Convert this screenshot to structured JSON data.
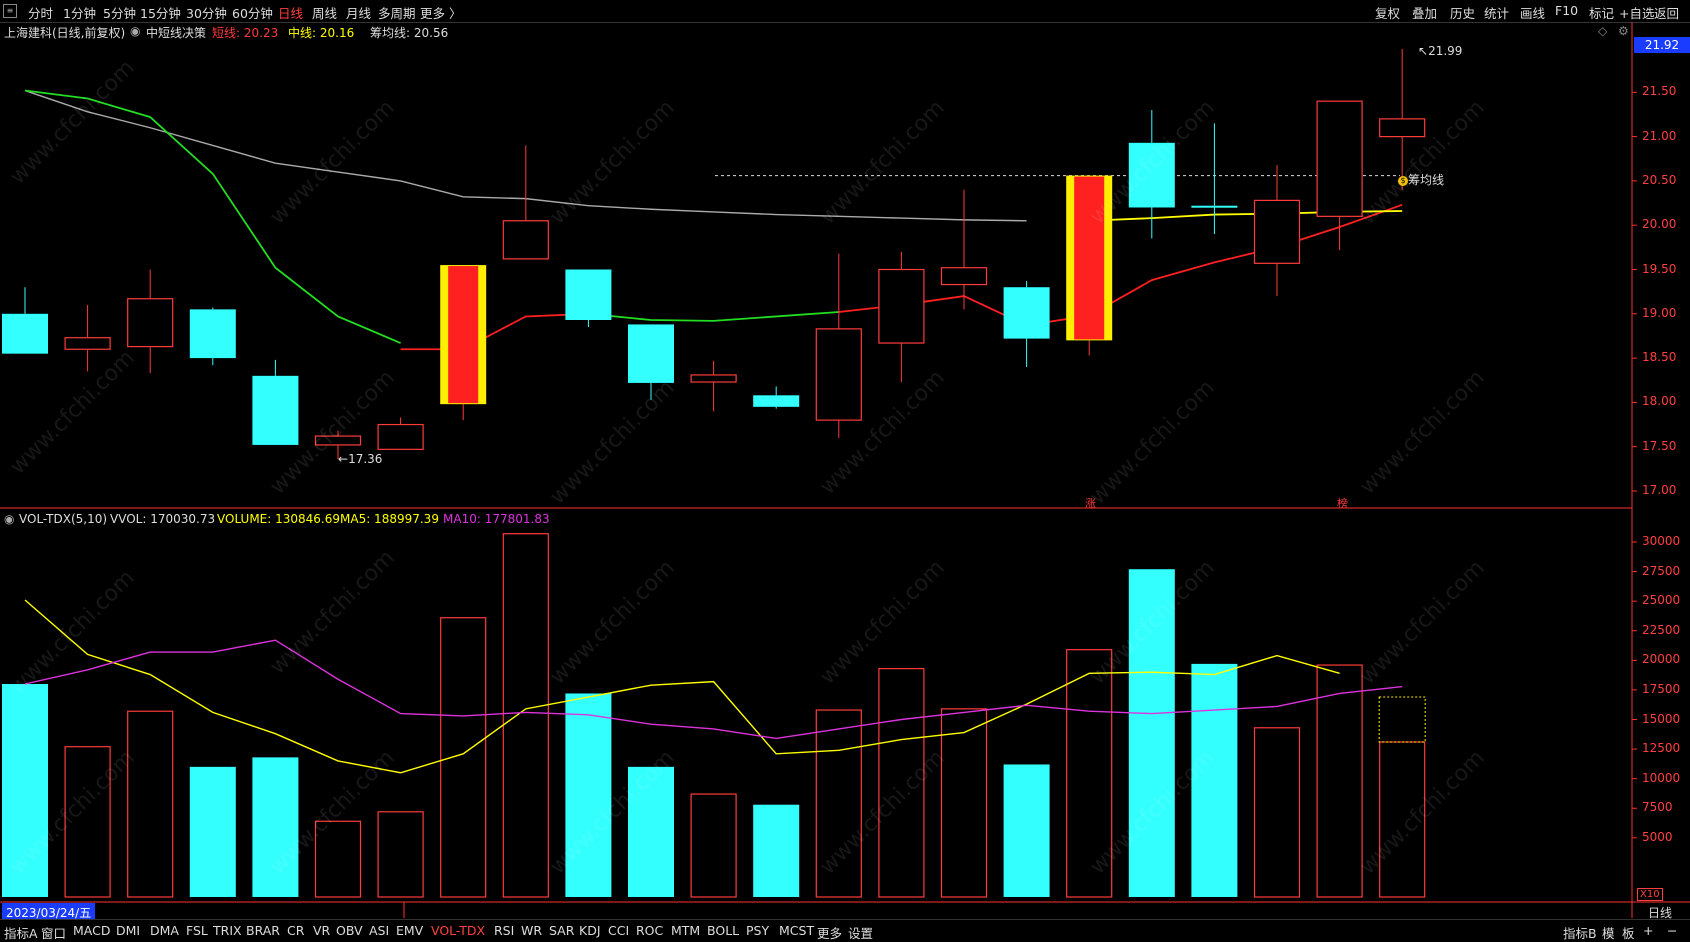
{
  "toolbar": {
    "periods": [
      "分时",
      "1分钟",
      "5分钟",
      "15分钟",
      "30分钟",
      "60分钟",
      "日线",
      "周线",
      "月线",
      "多周期",
      "更多 〉"
    ],
    "active_period": "日线",
    "right_items": [
      "复权",
      "叠加",
      "历史",
      "统计",
      "画线",
      "F10",
      "标记",
      "+自选",
      "返回"
    ]
  },
  "header": {
    "stock_title": "上海建科(日线,前复权)",
    "indicator_name": "中短线决策",
    "short_label": "短线: 20.23",
    "mid_label": "中线: 20.16",
    "chip_label": "筹均线: 20.56"
  },
  "price_axis": {
    "ticks": [
      "21.50",
      "21.00",
      "20.50",
      "20.00",
      "19.50",
      "19.00",
      "18.50",
      "18.00",
      "17.50",
      "17.00"
    ],
    "current_price": "21.92"
  },
  "annotations": {
    "high": "21.99",
    "low": "17.36",
    "chip_line_tag": "筹均线",
    "marker_zhang": "涨",
    "marker_bang": "榜"
  },
  "volume_header": {
    "name": "VOL-TDX(5,10)",
    "vvol": "VVOL: 170030.73",
    "volume": "VOLUME: 130846.69",
    "ma5": "MA5: 188997.39",
    "ma10": "MA10: 177801.83"
  },
  "volume_axis": {
    "ticks": [
      "30000",
      "27500",
      "25000",
      "22500",
      "20000",
      "17500",
      "15000",
      "12500",
      "10000",
      "7500",
      "5000"
    ],
    "multiplier": "X10"
  },
  "footer": {
    "date": "2023/03/24/五",
    "period": "日线",
    "indicators": [
      "指标A",
      "窗口",
      "MACD",
      "DMI",
      "DMA",
      "FSL",
      "TRIX",
      "BRAR",
      "CR",
      "VR",
      "OBV",
      "ASI",
      "EMV",
      "VOL-TDX",
      "RSI",
      "WR",
      "SAR",
      "KDJ",
      "CCI",
      "ROC",
      "MTM",
      "BOLL",
      "PSY",
      "MCST",
      "更多",
      "设置"
    ],
    "active_indicator": "VOL-TDX",
    "right_items": [
      "指标B",
      "模",
      "板",
      "+",
      "−"
    ]
  },
  "watermark": "www.cfchi.com",
  "colors": {
    "up": "#ff3b3b",
    "down": "#33ffff",
    "short_line": "#ff2020",
    "mid_line": "#ffff00",
    "green_line": "#22dd22",
    "gray_line": "#aaaaaa",
    "ma5": "#ffff00",
    "ma10": "#dd33dd",
    "highlight_fill": "#ff2020",
    "highlight_border": "#ffee00"
  },
  "chart_data": {
    "type": "candlestick",
    "candles": [
      {
        "o": 18.55,
        "c": 19.0,
        "h": 19.3,
        "l": 18.55,
        "dir": "down"
      },
      {
        "o": 18.6,
        "c": 18.73,
        "h": 19.1,
        "l": 18.35,
        "dir": "up"
      },
      {
        "o": 18.63,
        "c": 19.17,
        "h": 19.5,
        "l": 18.33,
        "dir": "up"
      },
      {
        "o": 19.05,
        "c": 18.5,
        "h": 19.07,
        "l": 18.42,
        "dir": "down"
      },
      {
        "o": 18.3,
        "c": 17.52,
        "h": 18.48,
        "l": 17.52,
        "dir": "down"
      },
      {
        "o": 17.52,
        "c": 17.62,
        "h": 17.68,
        "l": 17.36,
        "dir": "up"
      },
      {
        "o": 17.47,
        "c": 17.75,
        "h": 17.83,
        "l": 17.47,
        "dir": "up"
      },
      {
        "o": 17.98,
        "c": 19.55,
        "h": 19.55,
        "l": 17.8,
        "dir": "up",
        "hl": true
      },
      {
        "o": 19.62,
        "c": 20.05,
        "h": 20.9,
        "l": 19.62,
        "dir": "up"
      },
      {
        "o": 19.5,
        "c": 18.93,
        "h": 19.5,
        "l": 18.85,
        "dir": "down"
      },
      {
        "o": 18.88,
        "c": 18.22,
        "h": 18.88,
        "l": 18.03,
        "dir": "down"
      },
      {
        "o": 18.23,
        "c": 18.31,
        "h": 18.47,
        "l": 17.9,
        "dir": "up"
      },
      {
        "o": 18.08,
        "c": 17.95,
        "h": 18.18,
        "l": 17.93,
        "dir": "down"
      },
      {
        "o": 17.8,
        "c": 18.83,
        "h": 19.68,
        "l": 17.6,
        "dir": "up"
      },
      {
        "o": 18.67,
        "c": 19.5,
        "h": 19.7,
        "l": 18.23,
        "dir": "up"
      },
      {
        "o": 19.33,
        "c": 19.52,
        "h": 20.4,
        "l": 19.05,
        "dir": "up"
      },
      {
        "o": 19.3,
        "c": 18.72,
        "h": 19.37,
        "l": 18.4,
        "dir": "down"
      },
      {
        "o": 18.7,
        "c": 20.56,
        "h": 20.56,
        "l": 18.53,
        "dir": "up",
        "hl": true
      },
      {
        "o": 20.93,
        "c": 20.2,
        "h": 21.3,
        "l": 19.85,
        "dir": "down"
      },
      {
        "o": 20.22,
        "c": 20.2,
        "h": 21.15,
        "l": 19.9,
        "dir": "down"
      },
      {
        "o": 19.57,
        "c": 20.28,
        "h": 20.68,
        "l": 19.2,
        "dir": "up"
      },
      {
        "o": 20.1,
        "c": 21.4,
        "h": 21.4,
        "l": 19.72,
        "dir": "up"
      },
      {
        "o": 21.0,
        "c": 21.2,
        "h": 21.99,
        "l": 20.4,
        "dir": "up"
      }
    ],
    "short_line": [
      null,
      null,
      null,
      null,
      null,
      null,
      18.6,
      18.6,
      18.97,
      19.0,
      null,
      null,
      null,
      19.02,
      19.1,
      19.2,
      18.87,
      18.98,
      19.38,
      19.58,
      19.75,
      19.98,
      20.23
    ],
    "mid_line": [
      null,
      null,
      null,
      null,
      null,
      null,
      null,
      null,
      null,
      null,
      null,
      null,
      null,
      null,
      null,
      null,
      null,
      20.05,
      20.08,
      20.12,
      20.13,
      20.15,
      20.16
    ],
    "green_line": [
      21.52,
      21.43,
      21.22,
      20.58,
      19.52,
      18.97,
      18.67,
      null,
      null,
      19.0,
      18.93,
      18.92,
      18.97,
      19.02,
      null,
      null,
      null,
      null,
      null,
      null,
      null,
      null,
      null
    ],
    "gray_line": [
      21.52,
      21.28,
      21.1,
      20.9,
      20.7,
      20.6,
      20.5,
      20.32,
      20.3,
      20.22,
      20.18,
      20.15,
      20.12,
      20.1,
      20.08,
      20.06,
      20.05,
      null,
      null,
      null,
      null,
      null,
      null
    ],
    "chip_line_price": 20.56,
    "volume": {
      "values": [
        18000,
        12700,
        15700,
        11000,
        11800,
        6400,
        7200,
        23600,
        30700,
        17200,
        11000,
        8700,
        7800,
        15800,
        19300,
        15900,
        11200,
        20900,
        27700,
        19700,
        14300,
        19600,
        13100
      ],
      "dir": [
        "down",
        "up",
        "up",
        "down",
        "down",
        "up",
        "up",
        "up",
        "up",
        "down",
        "down",
        "up",
        "down",
        "up",
        "up",
        "up",
        "down",
        "up",
        "down",
        "down",
        "up",
        "up",
        "up"
      ],
      "ma5": [
        25100,
        20500,
        18800,
        15600,
        13800,
        11500,
        10500,
        12100,
        15900,
        16900,
        17900,
        18200,
        12100,
        12400,
        13300,
        13900,
        16300,
        18900,
        19000,
        18800,
        20400,
        18900
      ],
      "ma10": [
        18000,
        19200,
        20700,
        20700,
        21700,
        18400,
        15500,
        15300,
        15600,
        15400,
        14600,
        14200,
        13400,
        14200,
        15000,
        15600,
        16200,
        15700,
        15500,
        15800,
        16100,
        17200,
        17780
      ],
      "ghost_value": 16900
    }
  }
}
